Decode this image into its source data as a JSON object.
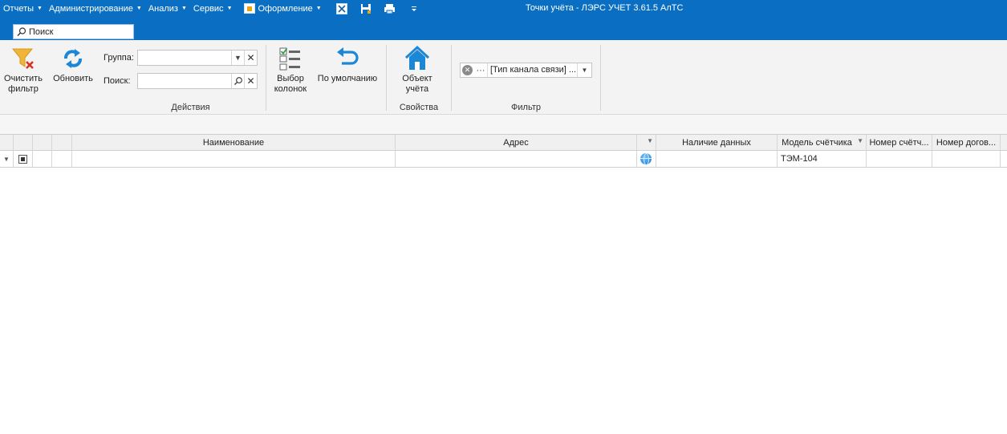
{
  "menu": {
    "items": [
      {
        "label": "Отчеты"
      },
      {
        "label": "Администрирование"
      },
      {
        "label": "Анализ"
      },
      {
        "label": "Сервис"
      },
      {
        "label": "Оформление"
      }
    ]
  },
  "window": {
    "title": "Точки учёта - ЛЭРС УЧЕТ 3.61.5 АлТС"
  },
  "search": {
    "placeholder": "Поиск"
  },
  "ribbon": {
    "actions": {
      "caption": "Действия",
      "clear_filter": "Очистить фильтр",
      "refresh": "Обновить",
      "group_label": "Группа:",
      "search_label": "Поиск:",
      "choose_columns": "Выбор колонок",
      "default": "По умолчанию"
    },
    "properties": {
      "caption": "Свойства",
      "object": "Объект учёта"
    },
    "filter": {
      "caption": "Фильтр",
      "value": "[Тип канала связи] ..."
    }
  },
  "grid": {
    "columns": {
      "name": "Наименование",
      "address": "Адрес",
      "data_presence": "Наличие данных",
      "meter_model": "Модель счётчика",
      "meter_number": "Номер счётч...",
      "contract_number": "Номер догов..."
    },
    "rows": [
      {
        "name": "",
        "address": "",
        "data_presence": "",
        "meter_model": "ТЭМ-104",
        "meter_number": "",
        "contract_number": ""
      }
    ]
  },
  "colors": {
    "titlebar": "#0a6fc2",
    "ribbon": "#f3f3f3",
    "accent_icon": "#1c87d6",
    "filter_icon": "#e8a317",
    "clear_x": "#d93025"
  }
}
